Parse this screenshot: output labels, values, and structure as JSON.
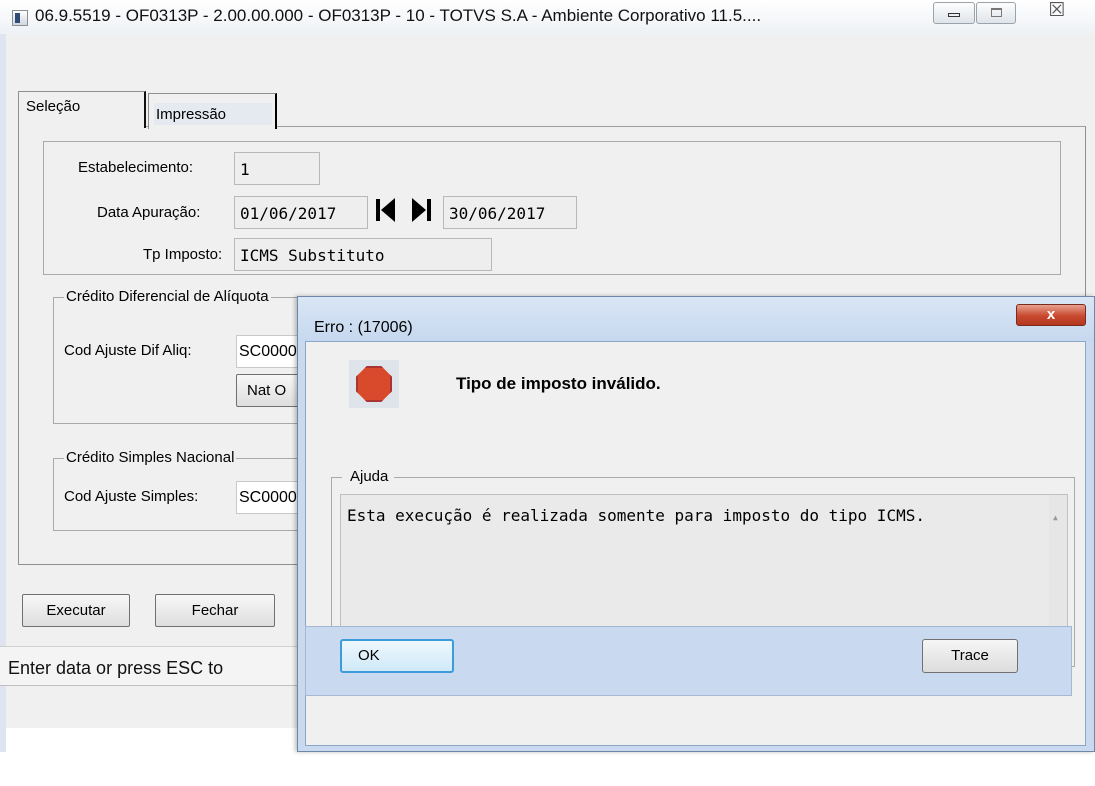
{
  "window": {
    "title": "06.9.5519 - OF0313P - 2.00.00.000 - OF0313P - 10 - TOTVS S.A - Ambiente Corporativo 11.5...."
  },
  "tabs": [
    {
      "label": "Seleção",
      "selected": true
    },
    {
      "label": "Impressão",
      "selected": false
    }
  ],
  "selecao": {
    "estabelecimento_label": "Estabelecimento:",
    "estabelecimento_value": "1",
    "data_apuracao_label": "Data Apuração:",
    "data_inicio": "01/06/2017",
    "data_fim": "30/06/2017",
    "tp_imposto_label": "Tp Imposto:",
    "tp_imposto_value": "ICMS Substituto"
  },
  "difal": {
    "group_title": "Crédito Diferencial de Alíquota",
    "cod_ajuste_label": "Cod Ajuste Dif Aliq:",
    "cod_ajuste_value": "SC0000",
    "nat_op_button": "Nat O"
  },
  "simples": {
    "group_title": "Crédito Simples Nacional",
    "cod_ajuste_label": "Cod Ajuste Simples:",
    "cod_ajuste_value": "SC0000"
  },
  "buttons": {
    "executar": "Executar",
    "fechar": "Fechar"
  },
  "status_bar": "Enter data or press ESC to",
  "error_dialog": {
    "title": "Erro : (17006)",
    "close_glyph": "x",
    "message": "Tipo de imposto inválido.",
    "help_title": "Ajuda",
    "help_text": "Esta execução é realizada somente para imposto do tipo ICMS.",
    "ok_label": "OK",
    "trace_label": "Trace"
  },
  "colors": {
    "dialog_frame": "#c9daf0",
    "close_button": "#c8492f",
    "stop_icon": "#d94a2c",
    "default_button_border": "#3c9bd9"
  }
}
